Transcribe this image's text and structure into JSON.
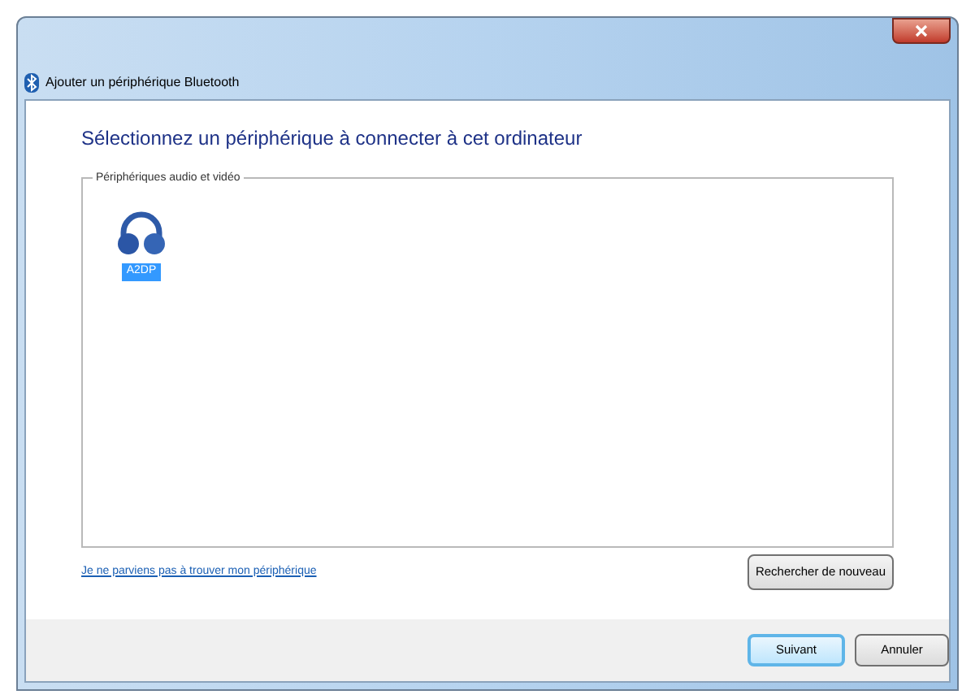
{
  "window": {
    "title": "Ajouter un périphérique Bluetooth"
  },
  "heading": "Sélectionnez un périphérique à connecter à cet ordinateur",
  "group": {
    "label": "Périphériques audio et vidéo",
    "devices": [
      {
        "name": "A2DP",
        "selected": true
      }
    ]
  },
  "link": "Je ne parviens pas à trouver mon périphérique",
  "search_button": "Rechercher de nouveau",
  "buttons": [
    {
      "label": "Suivant",
      "default": true
    },
    {
      "label": "Annuler",
      "default": false
    }
  ]
}
